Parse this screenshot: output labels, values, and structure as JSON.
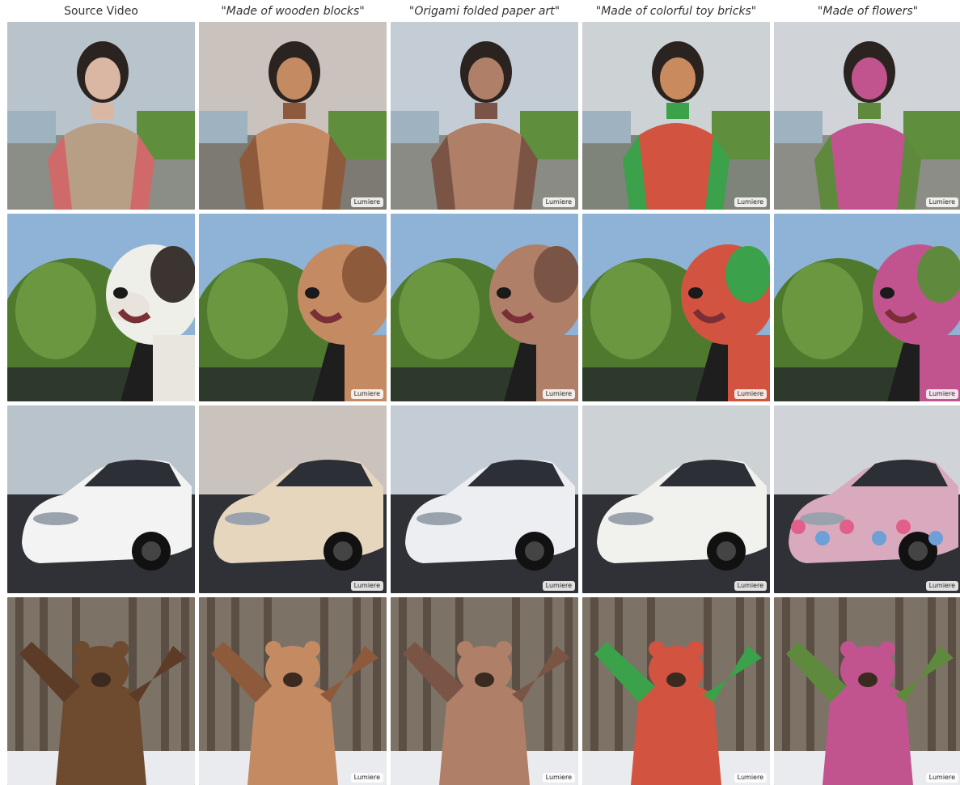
{
  "columns": [
    {
      "label": "Source Video",
      "quoted": false
    },
    {
      "label": "\"Made of wooden blocks\"",
      "quoted": true
    },
    {
      "label": "\"Origami folded paper art\"",
      "quoted": true
    },
    {
      "label": "\"Made of colorful toy bricks\"",
      "quoted": true
    },
    {
      "label": "\"Made of flowers\"",
      "quoted": true
    }
  ],
  "rows": [
    {
      "subject": "woman"
    },
    {
      "subject": "dog"
    },
    {
      "subject": "car"
    },
    {
      "subject": "bear"
    }
  ],
  "watermark": "Lumiere",
  "colors": {
    "header_text": "#333333",
    "background": "#ffffff"
  },
  "styles": [
    {
      "name": "source",
      "primary": "#8a7a6a",
      "accent": "#c55a5a",
      "bg_sky": "#b9c3cc",
      "bg_ground": "#8b8e86"
    },
    {
      "name": "wooden",
      "primary": "#c48a62",
      "accent": "#8d5a3b",
      "bg_sky": "#c9c2bd",
      "bg_ground": "#7c7a73"
    },
    {
      "name": "origami",
      "primary": "#b07f67",
      "accent": "#7a5546",
      "bg_sky": "#c4cdd6",
      "bg_ground": "#8b8b86"
    },
    {
      "name": "bricks",
      "primary": "#d2533f",
      "accent": "#3ba14a",
      "bg_sky": "#cdd2d5",
      "bg_ground": "#7e847a"
    },
    {
      "name": "flowers",
      "primary": "#c1548e",
      "accent": "#5f8a3e",
      "bg_sky": "#d0d4d8",
      "bg_ground": "#8c8d86"
    }
  ]
}
